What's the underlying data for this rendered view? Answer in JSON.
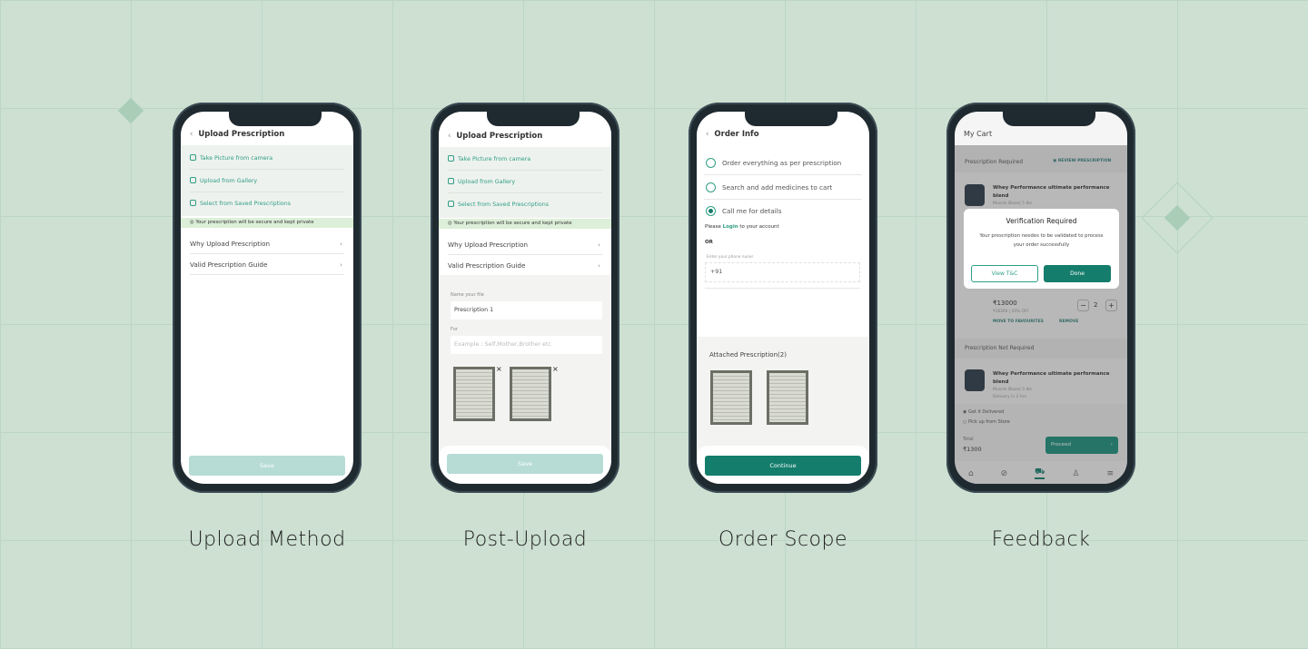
{
  "screens": {
    "upload_method": {
      "caption": "Upload Method",
      "title": "Upload Prescription",
      "options": [
        "Take Picture from camera",
        "Upload from Gallery",
        "Select from Saved Prescriptions"
      ],
      "banner": "Your prescription will be secure and kept private",
      "rows": [
        "Why Upload Prescription",
        "Valid Prescription Guide"
      ],
      "save": "Save"
    },
    "post_upload": {
      "caption": "Post-Upload",
      "title": "Upload Prescription",
      "options": [
        "Take Picture from camera",
        "Upload from Gallery",
        "Select from Saved Prescriptions"
      ],
      "banner": "Your prescription will be secure and kept private",
      "rows": [
        "Why Upload Prescription",
        "Valid Prescription Guide"
      ],
      "name_label": "Name your file",
      "name_value": "Prescription 1",
      "for_label": "For",
      "for_placeholder": "Example : Self,Mother,Brother etc",
      "remove": "×",
      "save": "Save"
    },
    "order_scope": {
      "caption": "Order Scope",
      "title": "Order Info",
      "radios": [
        "Order everything as per prescription",
        "Search and add medicines to cart",
        "Call me for details"
      ],
      "selected": 2,
      "please": "Please",
      "login": "Login",
      "to_account": "to your account",
      "or": "OR",
      "phone_label": "Enter your phone nuner",
      "phone_value": "+91",
      "attached": "Attached Prescription(2)",
      "continue": "Continue"
    },
    "feedback": {
      "caption": "Feedback",
      "title": "My Cart",
      "rx_required": "Prescription Required",
      "review": "REVIEW PRESCRIPTION",
      "product": "Whey Performance ultimate performance blend",
      "brand": "Muscle Blaze| 5 lbs",
      "price": "₹13000",
      "mrp": "₹16260 | 20% OFF",
      "qty": "2",
      "minus": "−",
      "plus": "+",
      "move_fav": "MOVE TO FAVOURITES",
      "remove": "REMOVE",
      "rx_not_required": "Prescription Not Required",
      "delivery": "Delivery in 2 hrs",
      "get_delivered": "Get it Delivered",
      "pickup": "Pick up from Store",
      "total_label": "Total",
      "total": "₹1300",
      "proceed": "Proceed",
      "modal_title": "Verification Required",
      "modal_text": "Your prescription needes to be validated  to process your order successfully",
      "view_tc": "View T&C",
      "done": "Done"
    }
  },
  "colors": {
    "background": "#cde0d2",
    "accent": "#147d6c",
    "link": "#2f9e84",
    "disabled_button": "#b7dcd6"
  }
}
